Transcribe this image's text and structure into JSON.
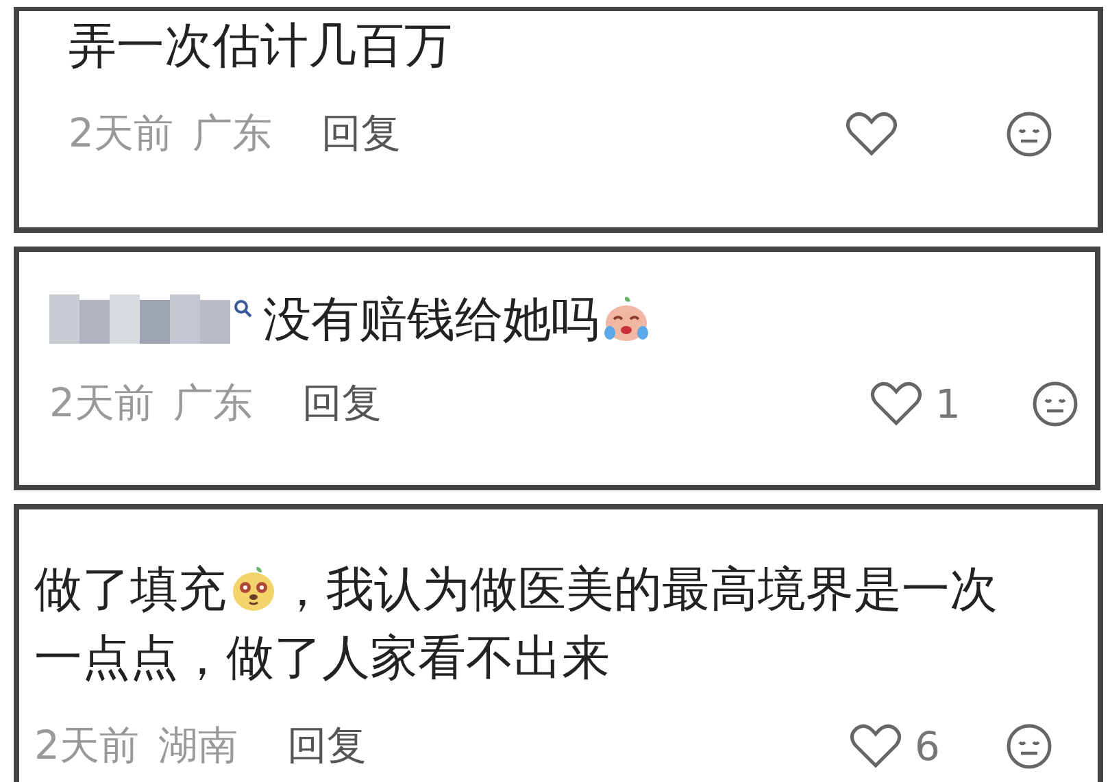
{
  "comments": [
    {
      "lines": [
        [
          {
            "kind": "text",
            "text": "弄一次估计几百万"
          }
        ]
      ],
      "time": "2天前",
      "region": "广东",
      "reply": "回复"
    },
    {
      "lines": [
        [
          {
            "kind": "pixelated-name"
          },
          {
            "kind": "text",
            "text": "没有赔钱给她吗"
          },
          {
            "kind": "crying-emoji"
          }
        ]
      ],
      "time": "2天前",
      "region": "广东",
      "reply": "回复",
      "likes": "1"
    },
    {
      "lines": [
        [
          {
            "kind": "text",
            "text": "做了填充"
          },
          {
            "kind": "dog-emoji"
          },
          {
            "kind": "text",
            "text": "，我认为做医美的最高境界是一次"
          }
        ],
        [
          {
            "kind": "text",
            "text": "一点点，做了人家看不出来"
          }
        ]
      ],
      "time": "2天前",
      "region": "湖南",
      "reply": "回复",
      "likes": "6"
    }
  ]
}
